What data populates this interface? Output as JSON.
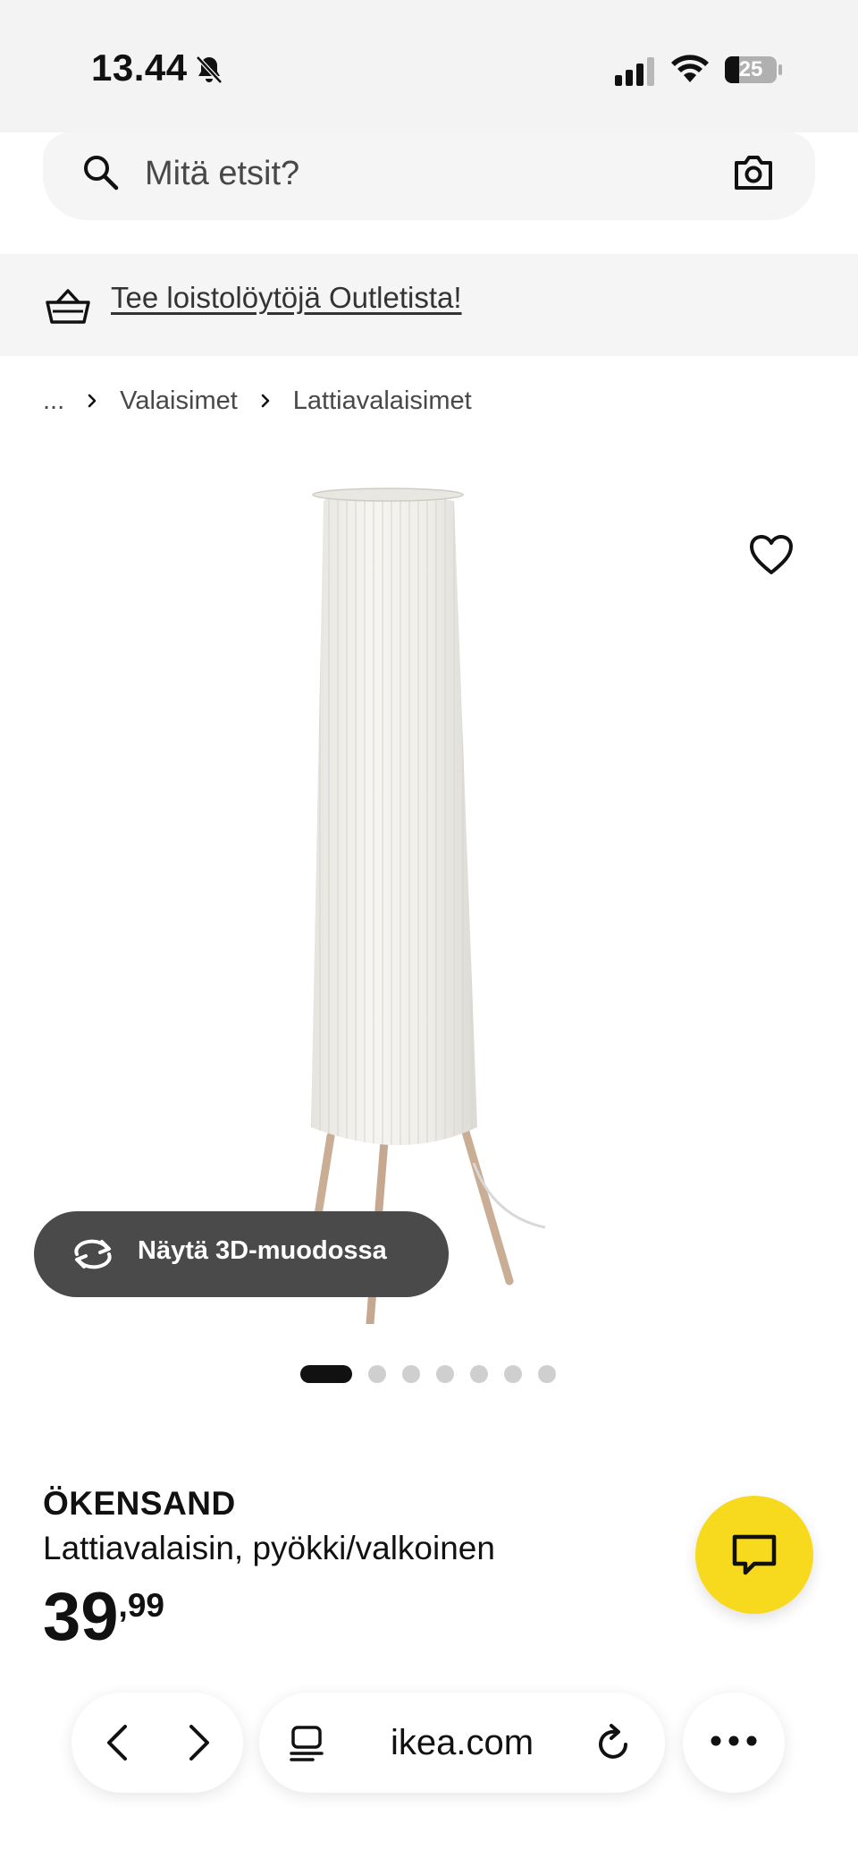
{
  "status_bar": {
    "time": "13.44",
    "battery": "25"
  },
  "search": {
    "placeholder": "Mitä etsit?"
  },
  "promo": {
    "link_text": "Tee loistolöytöjä Outletista!"
  },
  "breadcrumb": {
    "items": [
      "...",
      "Valaisimet",
      "Lattiavalaisimet"
    ]
  },
  "gallery": {
    "view_3d_label": "Näytä 3D-muodossa",
    "image_count": 7,
    "active_index": 0
  },
  "product": {
    "name": "ÖKENSAND",
    "description": "Lattiavalaisin, pyökki/valkoinen",
    "price_integer": "39",
    "price_decimal": ",99"
  },
  "browser": {
    "url": "ikea.com"
  },
  "colors": {
    "accent_yellow": "#f7d91d",
    "button_dark": "#4a4a4a"
  }
}
